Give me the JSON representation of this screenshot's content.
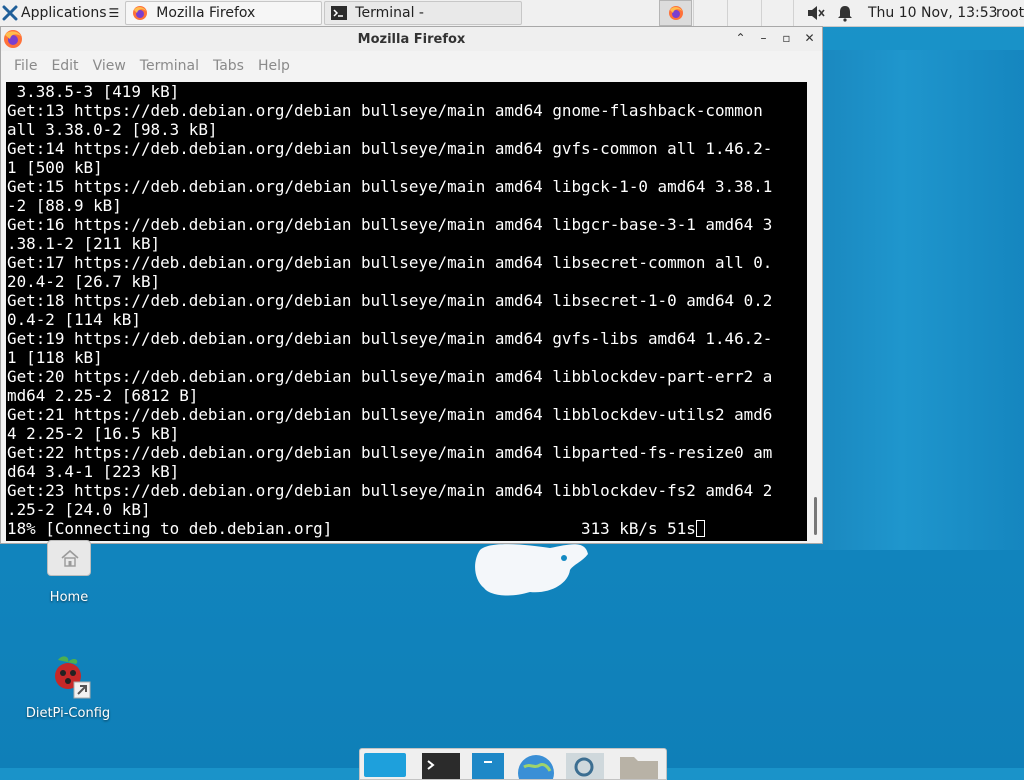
{
  "top_panel": {
    "applications_label": "Applications",
    "tasks": [
      {
        "label": "Mozilla Firefox",
        "icon": "firefox-icon"
      },
      {
        "label": "Terminal -",
        "icon": "terminal-icon"
      }
    ],
    "clock": "Thu 10 Nov, 13:53",
    "user": "root"
  },
  "window": {
    "title": "Mozilla Firefox",
    "menu": [
      "File",
      "Edit",
      "View",
      "Terminal",
      "Tabs",
      "Help"
    ]
  },
  "terminal": {
    "lines": [
      " 3.38.5-3 [419 kB]",
      "Get:13 https://deb.debian.org/debian bullseye/main amd64 gnome-flashback-common",
      "all 3.38.0-2 [98.3 kB]",
      "Get:14 https://deb.debian.org/debian bullseye/main amd64 gvfs-common all 1.46.2-",
      "1 [500 kB]",
      "Get:15 https://deb.debian.org/debian bullseye/main amd64 libgck-1-0 amd64 3.38.1",
      "-2 [88.9 kB]",
      "Get:16 https://deb.debian.org/debian bullseye/main amd64 libgcr-base-3-1 amd64 3",
      ".38.1-2 [211 kB]",
      "Get:17 https://deb.debian.org/debian bullseye/main amd64 libsecret-common all 0.",
      "20.4-2 [26.7 kB]",
      "Get:18 https://deb.debian.org/debian bullseye/main amd64 libsecret-1-0 amd64 0.2",
      "0.4-2 [114 kB]",
      "Get:19 https://deb.debian.org/debian bullseye/main amd64 gvfs-libs amd64 1.46.2-",
      "1 [118 kB]",
      "Get:20 https://deb.debian.org/debian bullseye/main amd64 libblockdev-part-err2 a",
      "md64 2.25-2 [6812 B]",
      "Get:21 https://deb.debian.org/debian bullseye/main amd64 libblockdev-utils2 amd6",
      "4 2.25-2 [16.5 kB]",
      "Get:22 https://deb.debian.org/debian bullseye/main amd64 libparted-fs-resize0 am",
      "d64 3.4-1 [223 kB]",
      "Get:23 https://deb.debian.org/debian bullseye/main amd64 libblockdev-fs2 amd64 2",
      ".25-2 [24.0 kB]"
    ],
    "status_line": "18% [Connecting to deb.debian.org]                          313 kB/s 51s"
  },
  "desktop": {
    "icons": [
      {
        "label": "Home",
        "icon": "home-folder-icon"
      },
      {
        "label": "DietPi-Config",
        "icon": "dietpi-icon"
      }
    ]
  },
  "colors": {
    "desktop_bg": "#1389c2",
    "terminal_bg": "#000000",
    "terminal_fg": "#ffffff",
    "panel_bg": "#f0f0f0"
  }
}
